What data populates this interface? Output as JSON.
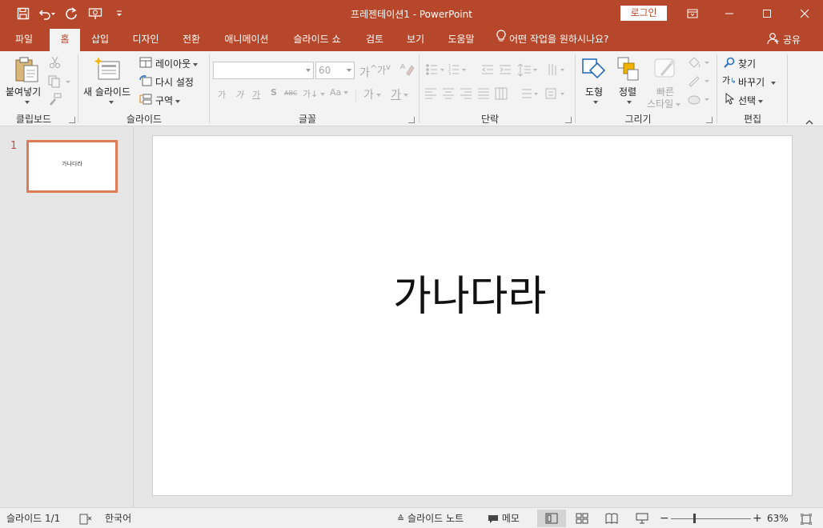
{
  "window": {
    "title": "프레젠테이션1  -  PowerPoint",
    "login_label": "로그인"
  },
  "qat": {
    "icons": [
      "save-icon",
      "undo-icon",
      "redo-icon",
      "present-icon",
      "customize-icon"
    ]
  },
  "tabs": [
    {
      "label": "파일"
    },
    {
      "label": "홈"
    },
    {
      "label": "삽입"
    },
    {
      "label": "디자인"
    },
    {
      "label": "전환"
    },
    {
      "label": "애니메이션"
    },
    {
      "label": "슬라이드 쇼"
    },
    {
      "label": "검토"
    },
    {
      "label": "보기"
    },
    {
      "label": "도움말"
    }
  ],
  "active_tab": "홈",
  "tellme": {
    "text": "어떤 작업을 원하시나요?"
  },
  "share": {
    "label": "공유"
  },
  "ribbon": {
    "clipboard": {
      "paste_label": "붙여넣기",
      "group_label": "클립보드"
    },
    "slides": {
      "new_slide_label": "새 슬라이드",
      "layout_label": "레이아웃",
      "reset_label": "다시 설정",
      "section_label": "구역",
      "group_label": "슬라이드"
    },
    "font": {
      "font_name_value": "",
      "font_size_value": "60",
      "group_label": "글꼴",
      "format_glyphs": [
        "가",
        "가",
        "가",
        "S",
        "ABC",
        "가↓",
        "Aa"
      ],
      "grow_glyph": "가",
      "shrink_glyph": "가",
      "highlight_glyph": "가",
      "fontcolor_glyph": "가"
    },
    "paragraph": {
      "group_label": "단락"
    },
    "drawing": {
      "shape_label": "도형",
      "arrange_label": "정렬",
      "quickstyle_label_1": "빠른",
      "quickstyle_label_2": "스타일",
      "group_label": "그리기"
    },
    "editing": {
      "find_label": "찾기",
      "replace_label": "바꾸기",
      "select_label": "선택",
      "replace_glyph": "가",
      "group_label": "편집"
    }
  },
  "thumbnails": [
    {
      "number": "1",
      "text": "가나다라"
    }
  ],
  "slide": {
    "title": "가나다라"
  },
  "statusbar": {
    "slide_counter": "슬라이드 1/1",
    "language": "한국어",
    "notes_label": "슬라이드 노트",
    "comments_label": "메모",
    "zoom_level": "63%",
    "zoom_percent": 63
  },
  "colors": {
    "accent": "#b7472a",
    "ribbon_bg": "#f3f3f3",
    "thumb_border": "#e07b57"
  }
}
